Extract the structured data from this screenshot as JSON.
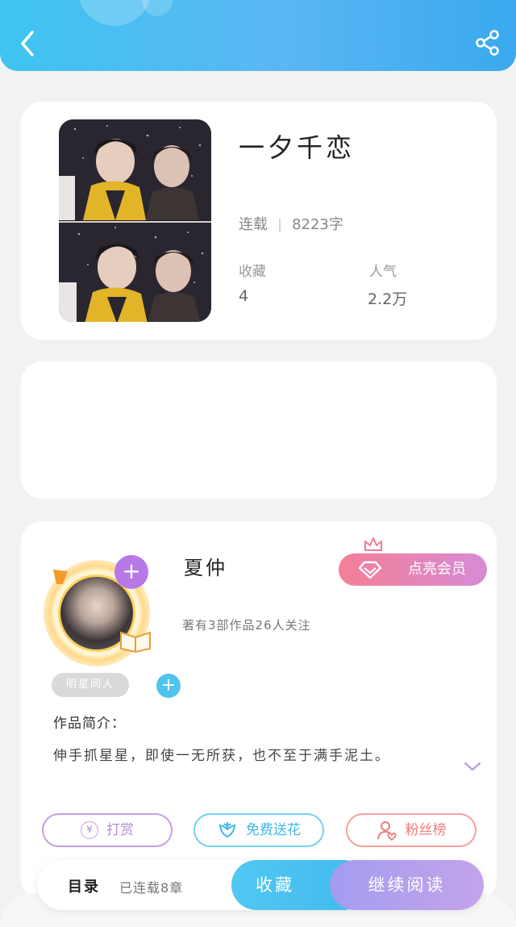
{
  "header": {
    "back_icon": "chevron-left-icon",
    "share_icon": "share-icon",
    "color_start": "#3fc4f0",
    "color_end": "#3aa9ee"
  },
  "book": {
    "title": "一夕千恋",
    "status": "连载",
    "word_count": "8223字",
    "favorites_label": "收藏",
    "favorites_value": "4",
    "popularity_label": "人气",
    "popularity_value": "2.2万"
  },
  "author": {
    "name": "夏仲",
    "stats": "著有3部作品26人关注",
    "vip_button": "点亮会员",
    "tag": "明星同人",
    "intro_label": "作品简介：",
    "intro_text": "伸手抓星星，即使一无所获，也不至于满手泥土。"
  },
  "actions": {
    "reward": "打赏",
    "reward_symbol": "¥",
    "flower": "免费送花",
    "fans": "粉丝榜"
  },
  "bottom_bar": {
    "toc": "目录",
    "chapters": "已连载8章",
    "collect": "收藏",
    "continue": "继续阅读"
  }
}
